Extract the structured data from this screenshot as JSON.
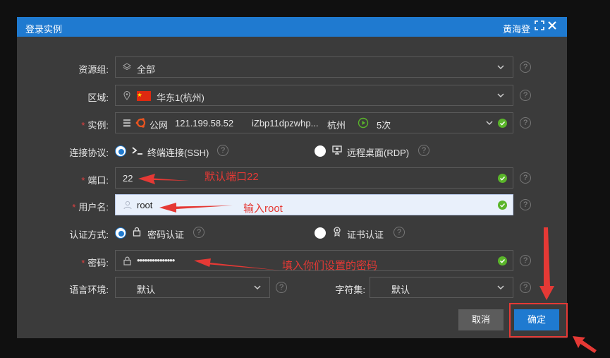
{
  "window": {
    "title": "登录实例",
    "user": "黄海登"
  },
  "form": {
    "resource_group": {
      "label": "资源组:",
      "value": "全部"
    },
    "region": {
      "label": "区域:",
      "value": "华东1(杭州)"
    },
    "instance": {
      "label": "实例:",
      "network": "公网",
      "ip": "121.199.58.52",
      "id": "iZbp11dpzwhp...",
      "city": "杭州",
      "count": "5次"
    },
    "protocol": {
      "label": "连接协议:",
      "options": [
        {
          "label": "终端连接(SSH)",
          "selected": true
        },
        {
          "label": "远程桌面(RDP)",
          "selected": false
        }
      ]
    },
    "port": {
      "label": "端口:",
      "value": "22"
    },
    "username": {
      "label": "用户名:",
      "value": "root"
    },
    "auth": {
      "label": "认证方式:",
      "options": [
        {
          "label": "密码认证",
          "selected": true
        },
        {
          "label": "证书认证",
          "selected": false
        }
      ]
    },
    "password": {
      "label": "密码:",
      "masked": "•••••••••••••••"
    },
    "language": {
      "label": "语言环境:",
      "value": "默认"
    },
    "charset": {
      "label": "字符集:",
      "value": "默认"
    }
  },
  "buttons": {
    "cancel": "取消",
    "confirm": "确定"
  },
  "annotations": {
    "port": "默认端口22",
    "username": "输入root",
    "password": "填入你们设置的密码"
  },
  "colors": {
    "title_bar": "#1f7ad0",
    "dialog_bg": "#3b3b3b",
    "confirm": "#1f7ad0",
    "cancel": "#5c5c5c",
    "annotation": "#e53935",
    "check": "#5ab52a"
  },
  "icons": [
    "fullscreen-icon",
    "close-icon",
    "layers-icon",
    "location-icon",
    "china-flag-icon",
    "server-icon",
    "ubuntu-icon",
    "play-circle-icon",
    "terminal-icon",
    "remote-desktop-icon",
    "lock-icon",
    "certificate-icon",
    "user-icon",
    "check-icon",
    "help-icon",
    "chevron-down-icon"
  ]
}
